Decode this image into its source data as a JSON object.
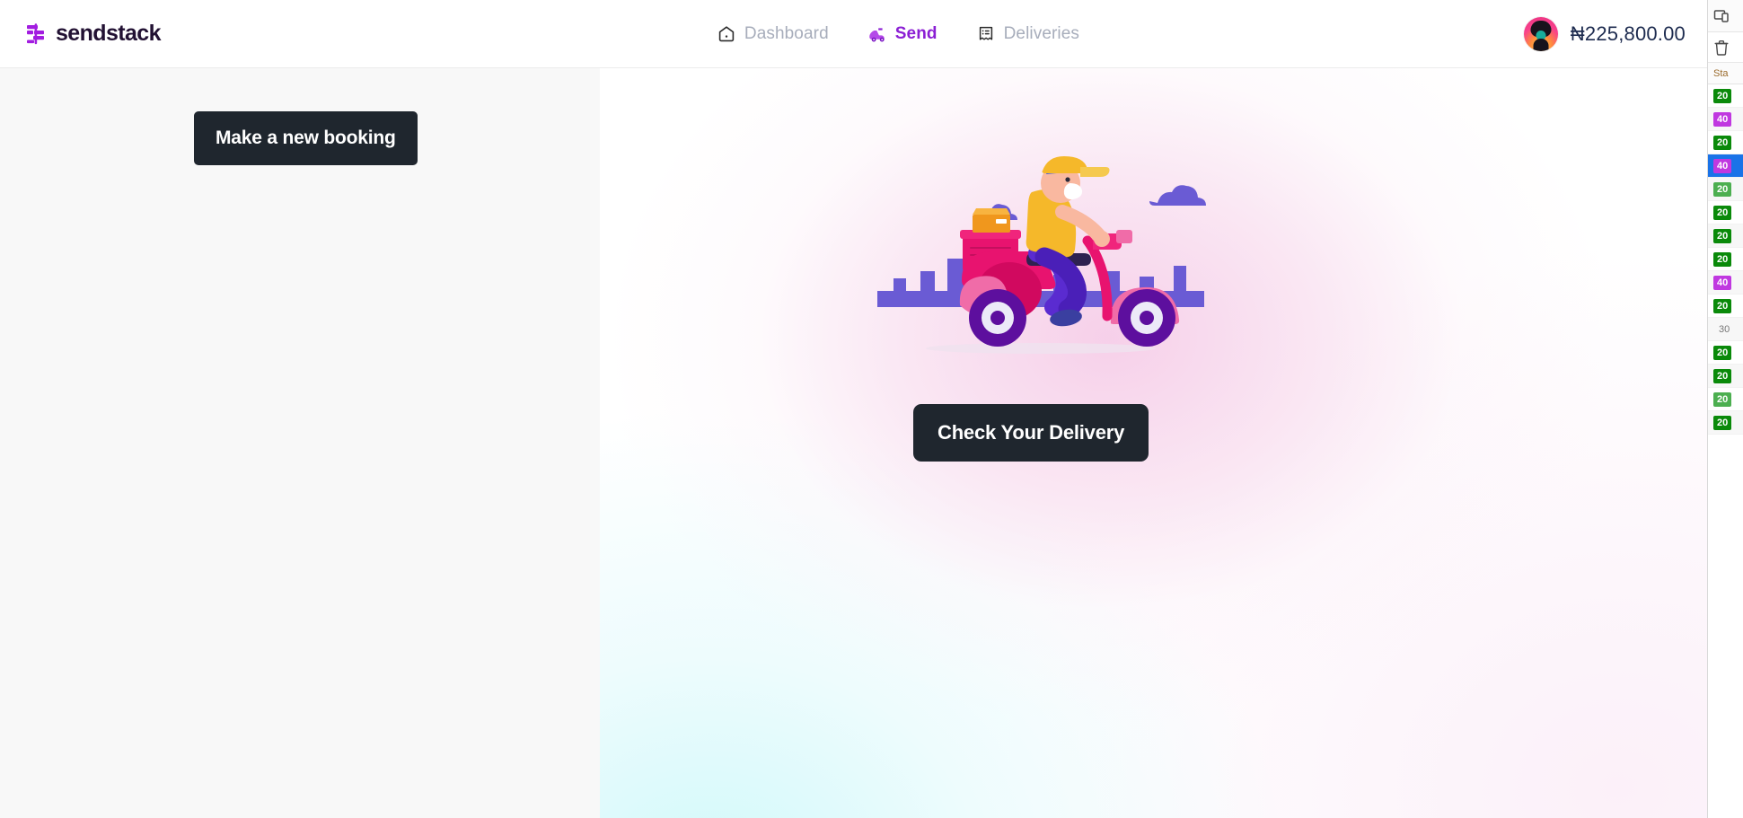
{
  "brand": {
    "name": "sendstack",
    "icon": "sendstack-logo-icon",
    "color": "#a21de0"
  },
  "header": {
    "nav": [
      {
        "label": "Dashboard",
        "icon": "home-icon",
        "active": false
      },
      {
        "label": "Send",
        "icon": "scooter-icon",
        "active": true
      },
      {
        "label": "Deliveries",
        "icon": "receipt-icon",
        "active": false
      }
    ],
    "account": {
      "avatar": "user-avatar",
      "balance": "₦225,800.00"
    }
  },
  "left_panel": {
    "booking_button": "Make a new booking"
  },
  "right_panel": {
    "illustration": "delivery-rider-scooter-illustration",
    "check_button": "Check Your Delivery"
  },
  "devtools": {
    "clear_icon": "trash-icon",
    "inspect_icon": "device-toolbar-icon",
    "column_header": "Sta",
    "rows": [
      {
        "status": "20",
        "kind": "s2",
        "selected": false,
        "alt": false
      },
      {
        "status": "40",
        "kind": "s4",
        "selected": false,
        "alt": true
      },
      {
        "status": "20",
        "kind": "s2",
        "selected": false,
        "alt": false
      },
      {
        "status": "40",
        "kind": "s4",
        "selected": true,
        "alt": false
      },
      {
        "status": "20",
        "kind": "s2l",
        "selected": false,
        "alt": true
      },
      {
        "status": "20",
        "kind": "s2",
        "selected": false,
        "alt": false
      },
      {
        "status": "20",
        "kind": "s2",
        "selected": false,
        "alt": true
      },
      {
        "status": "20",
        "kind": "s2",
        "selected": false,
        "alt": false
      },
      {
        "status": "40",
        "kind": "s4",
        "selected": false,
        "alt": true
      },
      {
        "status": "20",
        "kind": "s2",
        "selected": false,
        "alt": false
      },
      {
        "status": "30",
        "kind": "s3",
        "selected": false,
        "alt": true
      },
      {
        "status": "20",
        "kind": "s2",
        "selected": false,
        "alt": false
      },
      {
        "status": "20",
        "kind": "s2",
        "selected": false,
        "alt": true
      },
      {
        "status": "20",
        "kind": "s2l",
        "selected": false,
        "alt": false
      },
      {
        "status": "20",
        "kind": "s2",
        "selected": false,
        "alt": true
      }
    ]
  }
}
